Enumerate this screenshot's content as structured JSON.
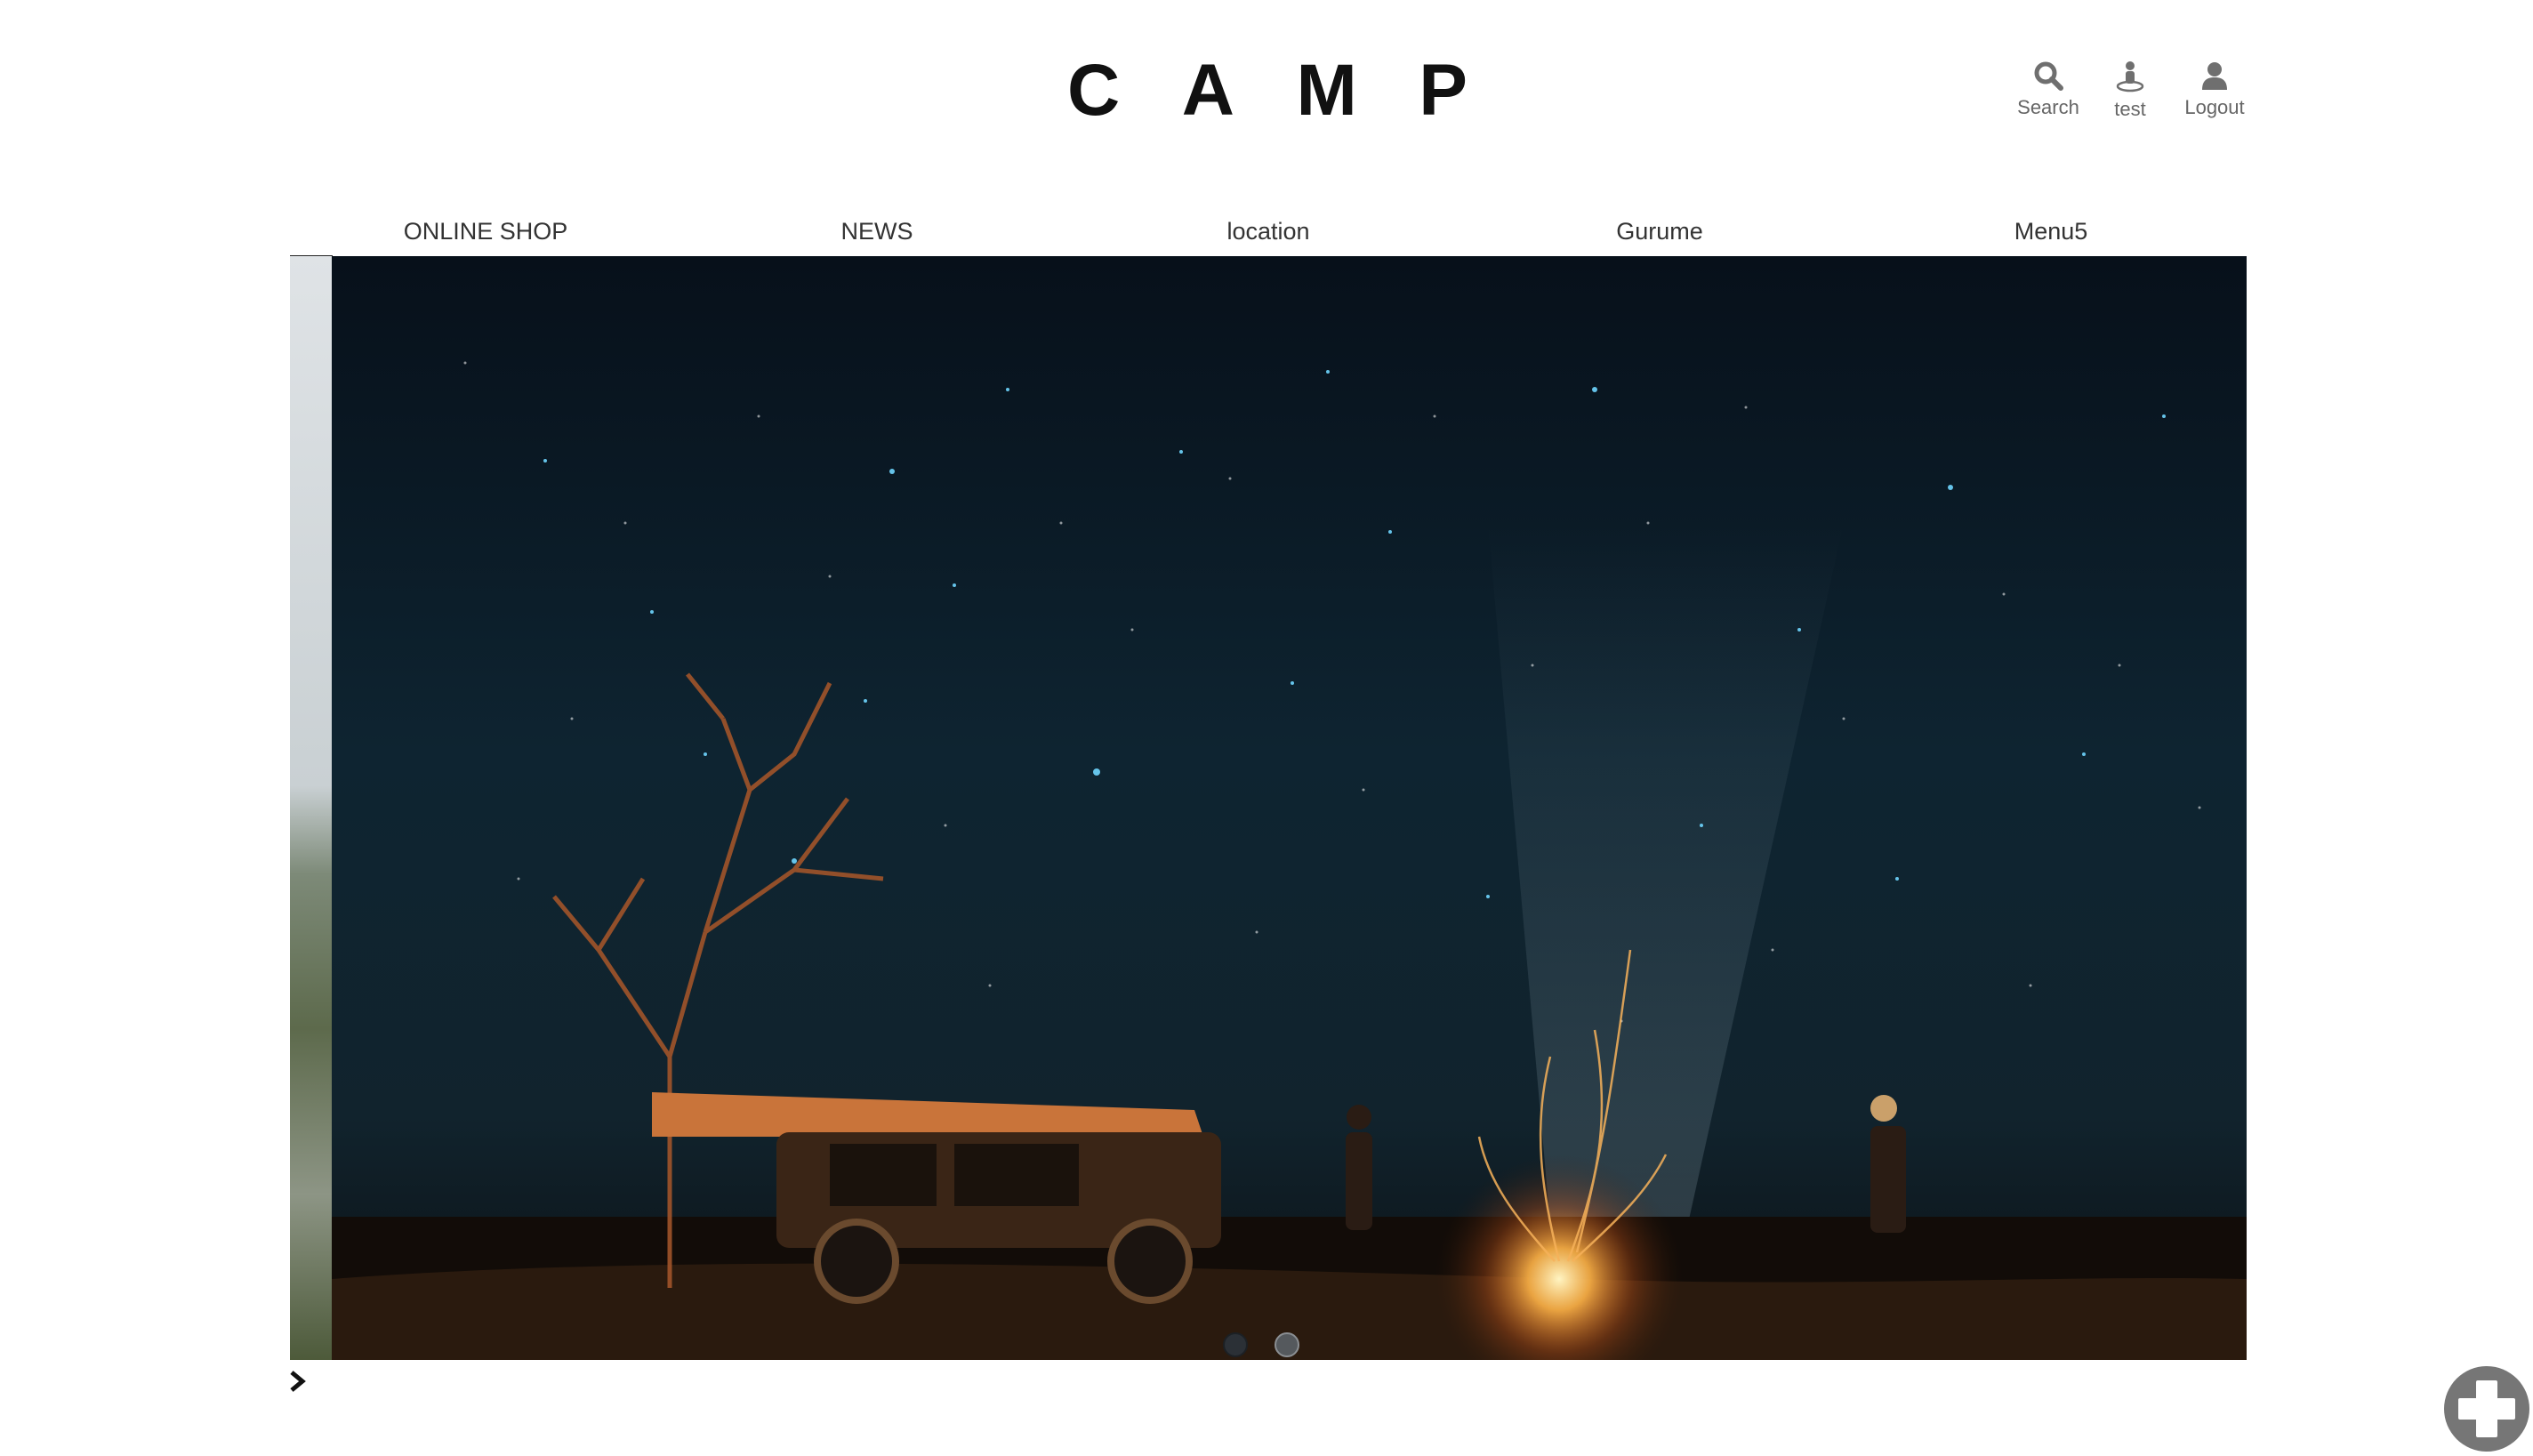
{
  "header": {
    "logo_letters": [
      "C",
      "A",
      "M",
      "P"
    ],
    "utility": {
      "search_label": "Search",
      "account_label": "test",
      "logout_label": "Logout"
    }
  },
  "nav": {
    "items": [
      {
        "label": "ONLINE SHOP"
      },
      {
        "label": "NEWS"
      },
      {
        "label": "location"
      },
      {
        "label": "Gurume"
      },
      {
        "label": "Menu5"
      }
    ]
  },
  "slider": {
    "slide_count": 2,
    "active_index": 1
  },
  "colors": {
    "text": "#333333",
    "logo": "#111111",
    "fab": "#767676"
  },
  "icons": [
    "search-icon",
    "person-pin-icon",
    "user-icon",
    "chevron-right-icon",
    "plus-icon"
  ]
}
